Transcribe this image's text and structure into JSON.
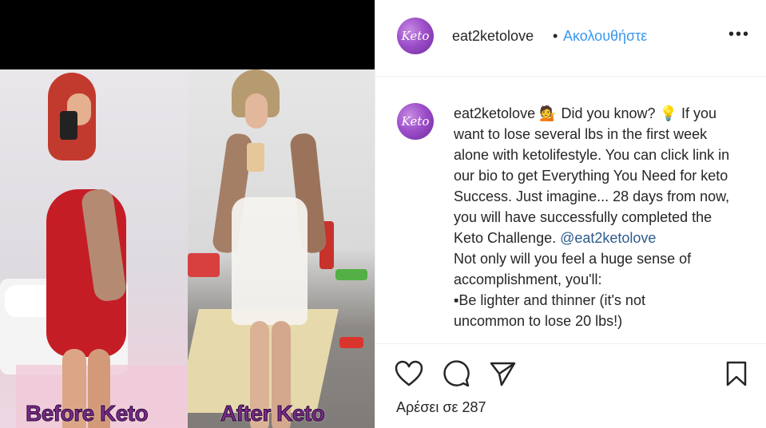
{
  "media": {
    "before_caption": "Before Keto",
    "after_caption": "After Keto"
  },
  "header": {
    "avatar_text": "Keto",
    "username": "eat2ketolove",
    "separator": "•",
    "follow_label": "Ακολουθήστε",
    "more_label": "•••"
  },
  "comment": {
    "avatar_text": "Keto",
    "username": "eat2ketolove",
    "line1": " 💁 Did you know? 💡 If you want to lose several lbs in the first week alone with ketolifestyle. You can click link in our bio to get Everything You Need for keto Success. Just imagine... 28 days from now, you will have successfully completed the Keto Challenge. ",
    "mention": "@eat2ketolove",
    "line2": "Not only will you feel a huge sense of accomplishment, you'll:",
    "line3": "▪Be lighter and thinner (it's not",
    "line4": "uncommon to lose 20 lbs!)"
  },
  "actions": {
    "like_icon": "heart-icon",
    "comment_icon": "comment-icon",
    "share_icon": "paper-plane-icon",
    "save_icon": "bookmark-icon"
  },
  "likes_text": "Αρέσει σε 287"
}
